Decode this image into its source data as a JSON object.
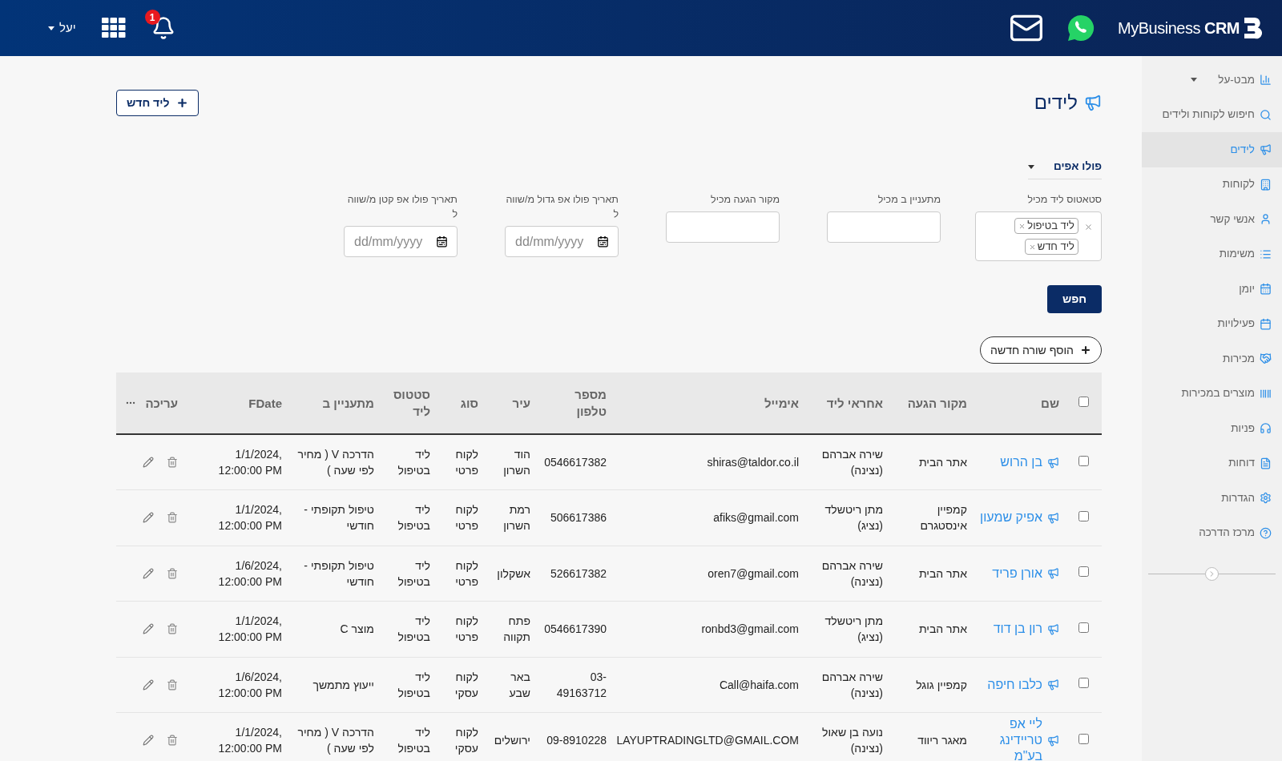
{
  "header": {
    "brand": {
      "name": "MyBusiness",
      "suffix": "CRM"
    },
    "user": "יעל",
    "notifications": "1"
  },
  "sidebar": {
    "items": [
      {
        "label": "מבט-על",
        "kind": "group",
        "selected": false
      },
      {
        "label": "חיפוש לקוחות ולידים",
        "kind": "link",
        "selected": false
      },
      {
        "label": "לידים",
        "kind": "link",
        "selected": true
      },
      {
        "label": "לקוחות",
        "kind": "link",
        "selected": false
      },
      {
        "label": "אנשי קשר",
        "kind": "link",
        "selected": false
      },
      {
        "label": "משימות",
        "kind": "link",
        "selected": false
      },
      {
        "label": "יומן",
        "kind": "link",
        "selected": false
      },
      {
        "label": "פעילויות",
        "kind": "link",
        "selected": false
      },
      {
        "label": "מכירות",
        "kind": "link",
        "selected": false
      },
      {
        "label": "מוצרים במכירות",
        "kind": "link",
        "selected": false
      },
      {
        "label": "פניות",
        "kind": "link",
        "selected": false
      },
      {
        "label": "דוחות",
        "kind": "link",
        "selected": false
      },
      {
        "label": "הגדרות",
        "kind": "link",
        "selected": false
      },
      {
        "label": "מרכז הדרכה",
        "kind": "link",
        "selected": false
      }
    ]
  },
  "page": {
    "title": "לידים",
    "new_button": "ליד חדש"
  },
  "filters": {
    "view": "פולו אפים",
    "fields": [
      {
        "kind": "tags",
        "label": "סטאטוס ליד מכיל",
        "tags": [
          "ליד בטיפול",
          "ליד חדש"
        ]
      },
      {
        "kind": "text",
        "label": "מתעניין ב מכיל"
      },
      {
        "kind": "text",
        "label": "מקור הגעה מכיל"
      },
      {
        "kind": "date",
        "label": "תאריך פולו אפ גדול מ/שווה ל",
        "placeholder": "dd/mm/yyyy"
      },
      {
        "kind": "date",
        "label": "תאריך פולו אפ קטן מ/שווה ל",
        "placeholder": "dd/mm/yyyy"
      }
    ],
    "search_button": "חפש"
  },
  "add_row_button": "הוסף שורה חדשה",
  "table": {
    "all_checked": false,
    "columns": [
      "שם",
      "מקור הגעה",
      "אחראי ליד",
      "אימייל",
      "מספר טלפון",
      "עיר",
      "סוג",
      "סטטוס ליד",
      "מתעניין ב",
      "FDate",
      "עריכה"
    ],
    "rows": [
      {
        "checked": false,
        "cells": [
          "בן הרוש",
          "אתר הבית",
          "שירה אברהם (נצינה)",
          "shiras@taldor.co.il",
          "0546617382",
          "הוד השרון",
          "לקוח פרטי",
          "ליד בטיפול",
          "הדרכה V ( מחיר לפי שעה )",
          "1/1/2024, 12:00:00 PM"
        ]
      },
      {
        "checked": false,
        "cells": [
          "אפיק שמעון",
          "קמפיין אינסטגרם",
          "מתן ריטשלד (נציג)",
          "afiks@gmail.com",
          "506617386",
          "רמת השרון",
          "לקוח פרטי",
          "ליד בטיפול",
          "טיפול תקופתי - חודשי",
          "1/1/2024, 12:00:00 PM"
        ]
      },
      {
        "checked": false,
        "cells": [
          "אורן פריד",
          "אתר הבית",
          "שירה אברהם (נצינה)",
          "oren7@gmail.com",
          "526617382",
          "אשקלון",
          "לקוח פרטי",
          "ליד בטיפול",
          "טיפול תקופתי - חודשי",
          "1/6/2024, 12:00:00 PM"
        ]
      },
      {
        "checked": false,
        "cells": [
          "רון בן דוד",
          "אתר הבית",
          "מתן ריטשלד (נציג)",
          "ronbd3@gmail.com",
          "0546617390",
          "פתח תקווה",
          "לקוח פרטי",
          "ליד בטיפול",
          "מוצר C",
          "1/1/2024, 12:00:00 PM"
        ]
      },
      {
        "checked": false,
        "cells": [
          "כלבו חיפה",
          "קמפיין גוגל",
          "שירה אברהם (נצינה)",
          "Call@haifa.com",
          "03-49163712",
          "באר שבע",
          "לקוח עסקי",
          "ליד בטיפול",
          "ייעוץ מתמשך",
          "1/6/2024, 12:00:00 PM"
        ]
      },
      {
        "checked": false,
        "cells": [
          "ליי אפ טריידינג בע\"מ",
          "מאגר ריווד",
          "נועה בן שאול (נצינה)",
          "LAYUPTRADINGLTD@GMAIL.COM",
          "09-8910228",
          "ירושלים",
          "לקוח עסקי",
          "ליד בטיפול",
          "הדרכה V ( מחיר לפי שעה )",
          "1/1/2024, 12:00:00 PM"
        ]
      }
    ]
  }
}
